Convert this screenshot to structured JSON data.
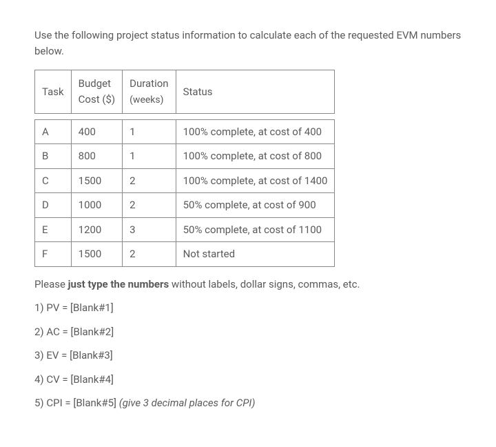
{
  "intro": "Use the following project status information to calculate each of the requested EVM numbers below.",
  "table": {
    "headers": {
      "task": "Task",
      "budget": "Budget",
      "cost": "Cost ($)",
      "duration": "Duration",
      "weeks": "(weeks)",
      "status": "Status"
    },
    "rows": [
      {
        "task": "A",
        "budget": "400",
        "duration": "1",
        "status": "100% complete, at cost of 400"
      },
      {
        "task": "B",
        "budget": "800",
        "duration": "1",
        "status": "100% complete, at cost of 800"
      },
      {
        "task": "C",
        "budget": "1500",
        "duration": "2",
        "status": "100% complete, at cost of 1400"
      },
      {
        "task": "D",
        "budget": "1000",
        "duration": "2",
        "status": "50% complete, at cost of 900"
      },
      {
        "task": "E",
        "budget": "1200",
        "duration": "3",
        "status": "50% complete, at cost of 1100"
      },
      {
        "task": "F",
        "budget": "1500",
        "duration": "2",
        "status": "Not started"
      }
    ]
  },
  "instructions": {
    "prefix": "Please ",
    "bold": "just type the numbers",
    "suffix": " without labels, dollar signs, commas, etc."
  },
  "questions": {
    "q1": "1) PV = [Blank#1]",
    "q2": "2) AC = [Blank#2]",
    "q3": "3) EV = [Blank#3]",
    "q4": "4) CV = [Blank#4]",
    "q5_prefix": "5) CPI = [Blank#5] ",
    "q5_note": "(give 3 decimal places for CPI)"
  }
}
